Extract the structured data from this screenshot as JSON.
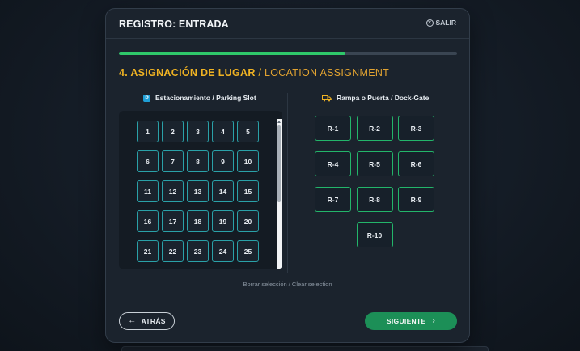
{
  "header": {
    "title": "REGISTRO: ENTRADA",
    "close_label": "SALIR"
  },
  "progress": {
    "percent": 67
  },
  "step": {
    "title_es": "4. ASIGNACIÓN DE LUGAR",
    "separator": "/",
    "title_en": "LOCATION ASSIGNMENT"
  },
  "parking": {
    "label": "Estacionamiento / Parking Slot",
    "icon_letter": "P",
    "slots": [
      "1",
      "2",
      "3",
      "4",
      "5",
      "6",
      "7",
      "8",
      "9",
      "10",
      "11",
      "12",
      "13",
      "14",
      "15",
      "16",
      "17",
      "18",
      "19",
      "20",
      "21",
      "22",
      "23",
      "24",
      "25"
    ]
  },
  "dock": {
    "label": "Rampa o Puerta / Dock-Gate",
    "gates": [
      "R-1",
      "R-2",
      "R-3",
      "R-4",
      "R-5",
      "R-6",
      "R-7",
      "R-8",
      "R-9",
      "R-10"
    ]
  },
  "clear_label": "Borrar selección / Clear selection",
  "footer": {
    "back_label": "ATRÁS",
    "next_label": "SIGUIENTE"
  },
  "colors": {
    "accent_green": "#2fc86a",
    "accent_amber": "#f0b323",
    "slot_border": "#2aa1a8",
    "gate_border": "#23b56a"
  }
}
